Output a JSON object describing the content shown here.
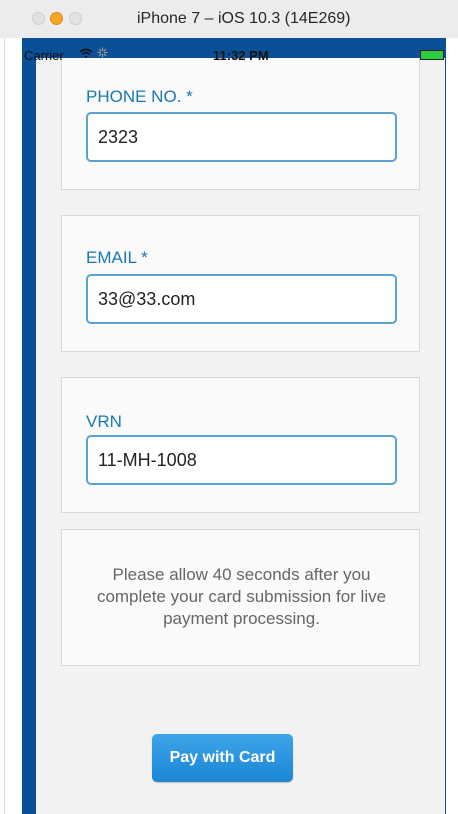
{
  "window": {
    "title": "iPhone 7 – iOS 10.3 (14E269)"
  },
  "statusbar": {
    "carrier": "Carrier",
    "wifi_icon": "wifi-icon",
    "spinner_icon": "activity-spinner-icon",
    "time": "11:32 PM",
    "battery_icon": "battery-icon"
  },
  "form": {
    "phone": {
      "label": "PHONE NO. *",
      "value": "2323"
    },
    "email": {
      "label": "EMAIL *",
      "value": "33@33.com"
    },
    "vrn": {
      "label": "VRN",
      "value": "11-MH-1008"
    }
  },
  "notice": {
    "text": "Please allow 40 seconds after you complete your card submission for live payment processing."
  },
  "actions": {
    "pay_label": "Pay with Card"
  },
  "colors": {
    "device_frame": "#0b4f96",
    "label": "#1878b5",
    "input_border": "#5aa3cf",
    "button": "#2a95df"
  }
}
